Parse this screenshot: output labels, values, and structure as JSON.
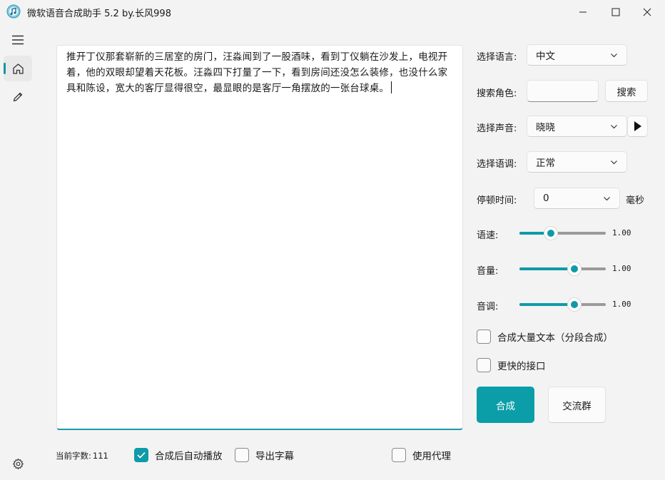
{
  "window": {
    "title": "微软语音合成助手 5.2 by.长风998",
    "icon": "app-music-icon"
  },
  "sidebar": {
    "items": [
      {
        "name": "menu",
        "icon": "hamburger-menu-icon"
      },
      {
        "name": "home",
        "icon": "home-icon",
        "selected": true
      },
      {
        "name": "edit",
        "icon": "pencil-icon"
      }
    ],
    "settings_icon": "gear-icon"
  },
  "editor": {
    "text": "推开丁仪那套崭新的三居室的房门，汪淼闻到了一股酒味，看到丁仪躺在沙发上，电视开着，他的双眼却望着天花板。汪淼四下打量了一下，看到房间还没怎么装修，也没什么家具和陈设，宽大的客厅显得很空，最显眼的是客厅一角摆放的一张台球桌。"
  },
  "status": {
    "char_count_label": "当前字数:",
    "char_count": "111",
    "auto_play_label": "合成后自动播放",
    "auto_play": true,
    "export_subtitle_label": "导出字幕",
    "export_subtitle": false,
    "use_proxy_label": "使用代理",
    "use_proxy": false
  },
  "settings": {
    "language_label": "选择语言:",
    "language_value": "中文",
    "search_label": "搜索角色:",
    "search_value": "",
    "search_button": "搜索",
    "voice_label": "选择声音:",
    "voice_value": "晓晓",
    "tone_label": "选择语调:",
    "tone_value": "正常",
    "pause_label": "停顿时间:",
    "pause_value": "0",
    "pause_unit": "毫秒",
    "speed_label": "语速:",
    "speed_value": "1.00",
    "speed_position": 0.36,
    "volume_label": "音量:",
    "volume_value": "1.00",
    "volume_position": 0.64,
    "pitch_label": "音调:",
    "pitch_value": "1.00",
    "pitch_position": 0.64,
    "bulk_text_label": "合成大量文本（分段合成）",
    "bulk_text": false,
    "faster_api_label": "更快的接口",
    "faster_api": false,
    "synthesize_button": "合成",
    "group_button": "交流群"
  },
  "colors": {
    "accent": "#0f9aa8",
    "background": "#f3f3f3"
  }
}
